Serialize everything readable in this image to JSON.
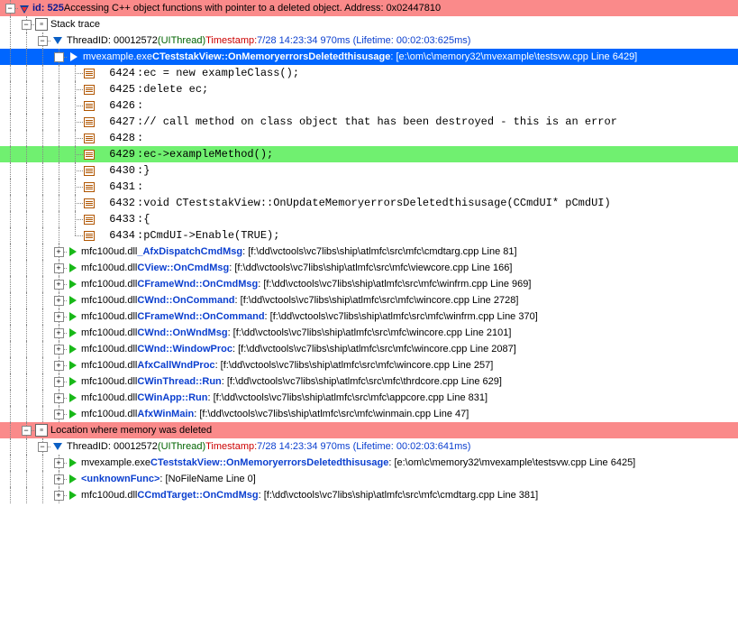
{
  "error_header": {
    "id_label": "id: 525",
    "text": "Accessing C++ object functions with pointer to a deleted object. Address: 0x02447810"
  },
  "stack_trace_label": "Stack trace",
  "thread1": {
    "label": "ThreadID: 00012572",
    "paren": "(UIThread)",
    "ts_label": "Timestamp:",
    "ts_val": "7/28 14:23:34 970ms (Lifetime: 00:02:03:625ms)"
  },
  "current_frame": {
    "module": "mvexample.exe",
    "func": "CTeststakView::OnMemoryerrorsDeletedthisusage",
    "loc": ": [e:\\om\\c\\memory32\\mvexample\\testsvw.cpp Line 6429]"
  },
  "code_lines": [
    {
      "n": "6424",
      "t": "      ec = new exampleClass();"
    },
    {
      "n": "6425",
      "t": "      delete ec;"
    },
    {
      "n": "6426",
      "t": ""
    },
    {
      "n": "6427",
      "t": "      // call method on class object that has been destroyed - this is an error"
    },
    {
      "n": "6428",
      "t": ""
    },
    {
      "n": "6429",
      "t": "      ec->exampleMethod();",
      "hi": true
    },
    {
      "n": "6430",
      "t": "}"
    },
    {
      "n": "6431",
      "t": ""
    },
    {
      "n": "6432",
      "t": "void CTeststakView::OnUpdateMemoryerrorsDeletedthisusage(CCmdUI* pCmdUI)"
    },
    {
      "n": "6433",
      "t": "{"
    },
    {
      "n": "6434",
      "t": "   pCmdUI->Enable(TRUE);"
    }
  ],
  "frames": [
    {
      "module": "mfc100ud.dll",
      "func": "_AfxDispatchCmdMsg",
      "loc": ": [f:\\dd\\vctools\\vc7libs\\ship\\atlmfc\\src\\mfc\\cmdtarg.cpp Line 81]"
    },
    {
      "module": "mfc100ud.dll",
      "func": "CView::OnCmdMsg",
      "loc": ": [f:\\dd\\vctools\\vc7libs\\ship\\atlmfc\\src\\mfc\\viewcore.cpp Line 166]"
    },
    {
      "module": "mfc100ud.dll",
      "func": "CFrameWnd::OnCmdMsg",
      "loc": ": [f:\\dd\\vctools\\vc7libs\\ship\\atlmfc\\src\\mfc\\winfrm.cpp Line 969]"
    },
    {
      "module": "mfc100ud.dll",
      "func": "CWnd::OnCommand",
      "loc": ": [f:\\dd\\vctools\\vc7libs\\ship\\atlmfc\\src\\mfc\\wincore.cpp Line 2728]"
    },
    {
      "module": "mfc100ud.dll",
      "func": "CFrameWnd::OnCommand",
      "loc": ": [f:\\dd\\vctools\\vc7libs\\ship\\atlmfc\\src\\mfc\\winfrm.cpp Line 370]"
    },
    {
      "module": "mfc100ud.dll",
      "func": "CWnd::OnWndMsg",
      "loc": ": [f:\\dd\\vctools\\vc7libs\\ship\\atlmfc\\src\\mfc\\wincore.cpp Line 2101]"
    },
    {
      "module": "mfc100ud.dll",
      "func": "CWnd::WindowProc",
      "loc": ": [f:\\dd\\vctools\\vc7libs\\ship\\atlmfc\\src\\mfc\\wincore.cpp Line 2087]"
    },
    {
      "module": "mfc100ud.dll",
      "func": "AfxCallWndProc",
      "loc": ": [f:\\dd\\vctools\\vc7libs\\ship\\atlmfc\\src\\mfc\\wincore.cpp Line 257]"
    },
    {
      "module": "mfc100ud.dll",
      "func": "CWinThread::Run",
      "loc": ": [f:\\dd\\vctools\\vc7libs\\ship\\atlmfc\\src\\mfc\\thrdcore.cpp Line 629]"
    },
    {
      "module": "mfc100ud.dll",
      "func": "CWinApp::Run",
      "loc": ": [f:\\dd\\vctools\\vc7libs\\ship\\atlmfc\\src\\mfc\\appcore.cpp Line 831]"
    },
    {
      "module": "mfc100ud.dll",
      "func": "AfxWinMain",
      "loc": ": [f:\\dd\\vctools\\vc7libs\\ship\\atlmfc\\src\\mfc\\winmain.cpp Line 47]"
    }
  ],
  "location_deleted_label": "Location where memory was deleted",
  "thread2": {
    "label": "ThreadID: 00012572",
    "paren": "(UIThread)",
    "ts_label": "Timestamp:",
    "ts_val": "7/28 14:23:34 970ms (Lifetime: 00:02:03:641ms)"
  },
  "frames2": [
    {
      "module": "mvexample.exe",
      "func": "CTeststakView::OnMemoryerrorsDeletedthisusage",
      "loc": ": [e:\\om\\c\\memory32\\mvexample\\testsvw.cpp Line 6425]"
    },
    {
      "module": "",
      "func": "<unknownFunc>",
      "loc": ": [NoFileName Line 0]"
    },
    {
      "module": "mfc100ud.dll",
      "func": "CCmdTarget::OnCmdMsg",
      "loc": ": [f:\\dd\\vctools\\vc7libs\\ship\\atlmfc\\src\\mfc\\cmdtarg.cpp Line 381]"
    }
  ]
}
